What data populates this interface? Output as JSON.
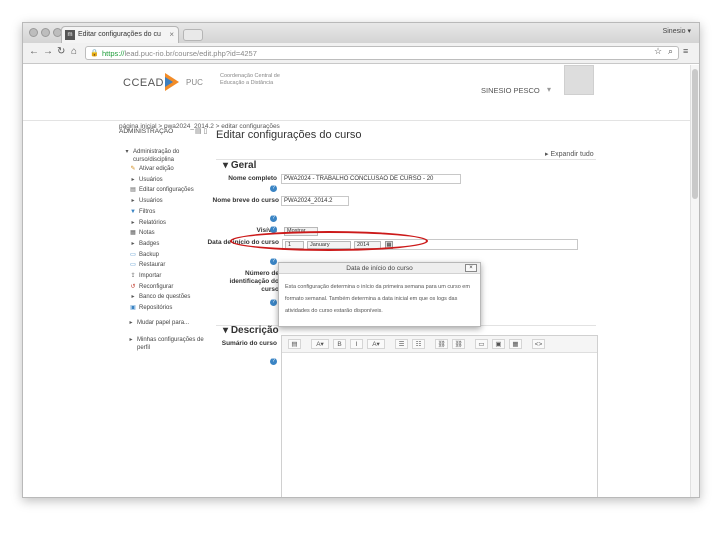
{
  "browser": {
    "tab_title": "Editar configurações do cu",
    "tab_favicon": "m",
    "tab_close": "×",
    "user_chip": "Sinesio ▾",
    "url_https": "https://",
    "url_rest": "lead.puc-rio.br/course/edit.php?id=4257",
    "icons": [
      "back-icon",
      "forward-icon",
      "reload-icon",
      "home-icon",
      "lock-icon",
      "star-icon",
      "search-icon",
      "menu-icon"
    ]
  },
  "header": {
    "logo_text": "CCEAD",
    "logo_puc": "PUC",
    "logo_sub": "Coordenação Central de Educação a Distância",
    "user_name": "SINESIO PESCO",
    "breadcrumb": "página inicial  >  pwa2024_2014.2  >  editar configurações"
  },
  "sidebar": {
    "title": "ADMINISTRAÇÃO",
    "section": "Administração do curso/disciplina",
    "items": [
      {
        "label": "Ativar edição",
        "icon": "pencil-icon"
      },
      {
        "label": "Usuários",
        "icon": "caret-icon"
      },
      {
        "label": "Editar configurações",
        "icon": "settings-icon"
      },
      {
        "label": "Usuários",
        "icon": "caret-icon"
      },
      {
        "label": "Filtros",
        "icon": "filter-icon"
      },
      {
        "label": "Relatórios",
        "icon": "caret-icon"
      },
      {
        "label": "Notas",
        "icon": "grades-icon"
      },
      {
        "label": "Badges",
        "icon": "caret-icon"
      },
      {
        "label": "Backup",
        "icon": "backup-icon"
      },
      {
        "label": "Restaurar",
        "icon": "restore-icon"
      },
      {
        "label": "Importar",
        "icon": "import-icon"
      },
      {
        "label": "Reconfigurar",
        "icon": "reset-icon"
      },
      {
        "label": "Banco de questões",
        "icon": "caret-icon"
      },
      {
        "label": "Repositórios",
        "icon": "repository-icon"
      }
    ],
    "role": "Mudar papel para...",
    "profile": "Minhas configurações de perfil"
  },
  "main": {
    "title": "Editar configurações do curso",
    "expand_all": "Expandir tudo",
    "section_general": "Geral",
    "fullname_label": "Nome completo",
    "fullname_value": "PWA2024 - TRABALHO CONCLUSÃO DE CURSO - 20",
    "shortname_label": "Nome breve do curso",
    "shortname_value": "PWA2024_2014.2",
    "visible_label": "Visível",
    "visible_value": "Mostrar",
    "startdate_label": "Data de início do curso",
    "start_day": "1",
    "start_month": "January",
    "start_year": "2014",
    "idnumber_label": "Número de identificação do curso",
    "section_description": "Descrição",
    "summary_label": "Sumário do curso"
  },
  "popup": {
    "title": "Data de início do curso",
    "close": "×",
    "body": "Esta configuração determina o início da primeira semana para um curso em formato semanal. Também determina a data inicial em que os logs das atividades do curso estarão disponíveis."
  },
  "editor": {
    "toolbar": [
      "▤",
      "A▾",
      "B",
      "I",
      "A▾",
      "☰",
      "☷",
      "⛓",
      "⛓",
      "▭",
      "▣",
      "▦",
      "<>"
    ]
  },
  "colors": {
    "highlight": "#cc1a1a",
    "help": "#3a84c4",
    "https": "#1e9d3a"
  }
}
